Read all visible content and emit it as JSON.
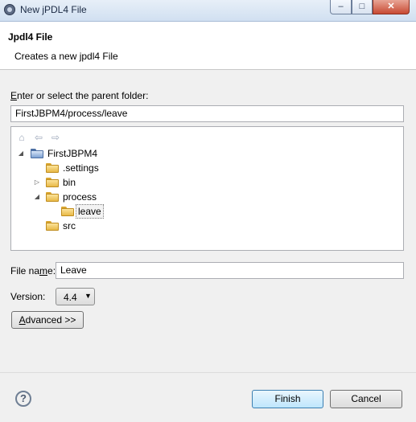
{
  "window": {
    "title": "New jPDL4 File",
    "controls": {
      "minimize": "–",
      "maximize": "□",
      "close": "✕"
    }
  },
  "header": {
    "title": "Jpdl4 File",
    "description": "Creates a new jpdl4 File"
  },
  "parent_folder": {
    "label_accel": "E",
    "label_rest": "nter or select the parent folder:",
    "value": "FirstJBPM4/process/leave"
  },
  "tree": {
    "nav_icons": [
      "home-icon",
      "back-icon",
      "forward-icon"
    ],
    "items": [
      {
        "label": "FirstJBPM4",
        "expander": "expanded",
        "icon": "project-folder-icon"
      },
      {
        "label": ".settings",
        "expander": "none",
        "icon": "folder-icon"
      },
      {
        "label": "bin",
        "expander": "collapsed",
        "icon": "folder-icon"
      },
      {
        "label": "process",
        "expander": "expanded",
        "icon": "folder-icon"
      },
      {
        "label": "leave",
        "expander": "none",
        "icon": "folder-open-icon",
        "selected": true
      },
      {
        "label": "src",
        "expander": "none",
        "icon": "folder-icon"
      }
    ]
  },
  "file_name": {
    "label_before": "File na",
    "label_accel": "m",
    "label_after": "e:",
    "value": "Leave"
  },
  "version": {
    "label": "Version:",
    "selected": "4.4"
  },
  "advanced_button": {
    "accel": "A",
    "rest": "dvanced >>"
  },
  "footer": {
    "help": "?",
    "finish": "Finish",
    "cancel": "Cancel"
  }
}
